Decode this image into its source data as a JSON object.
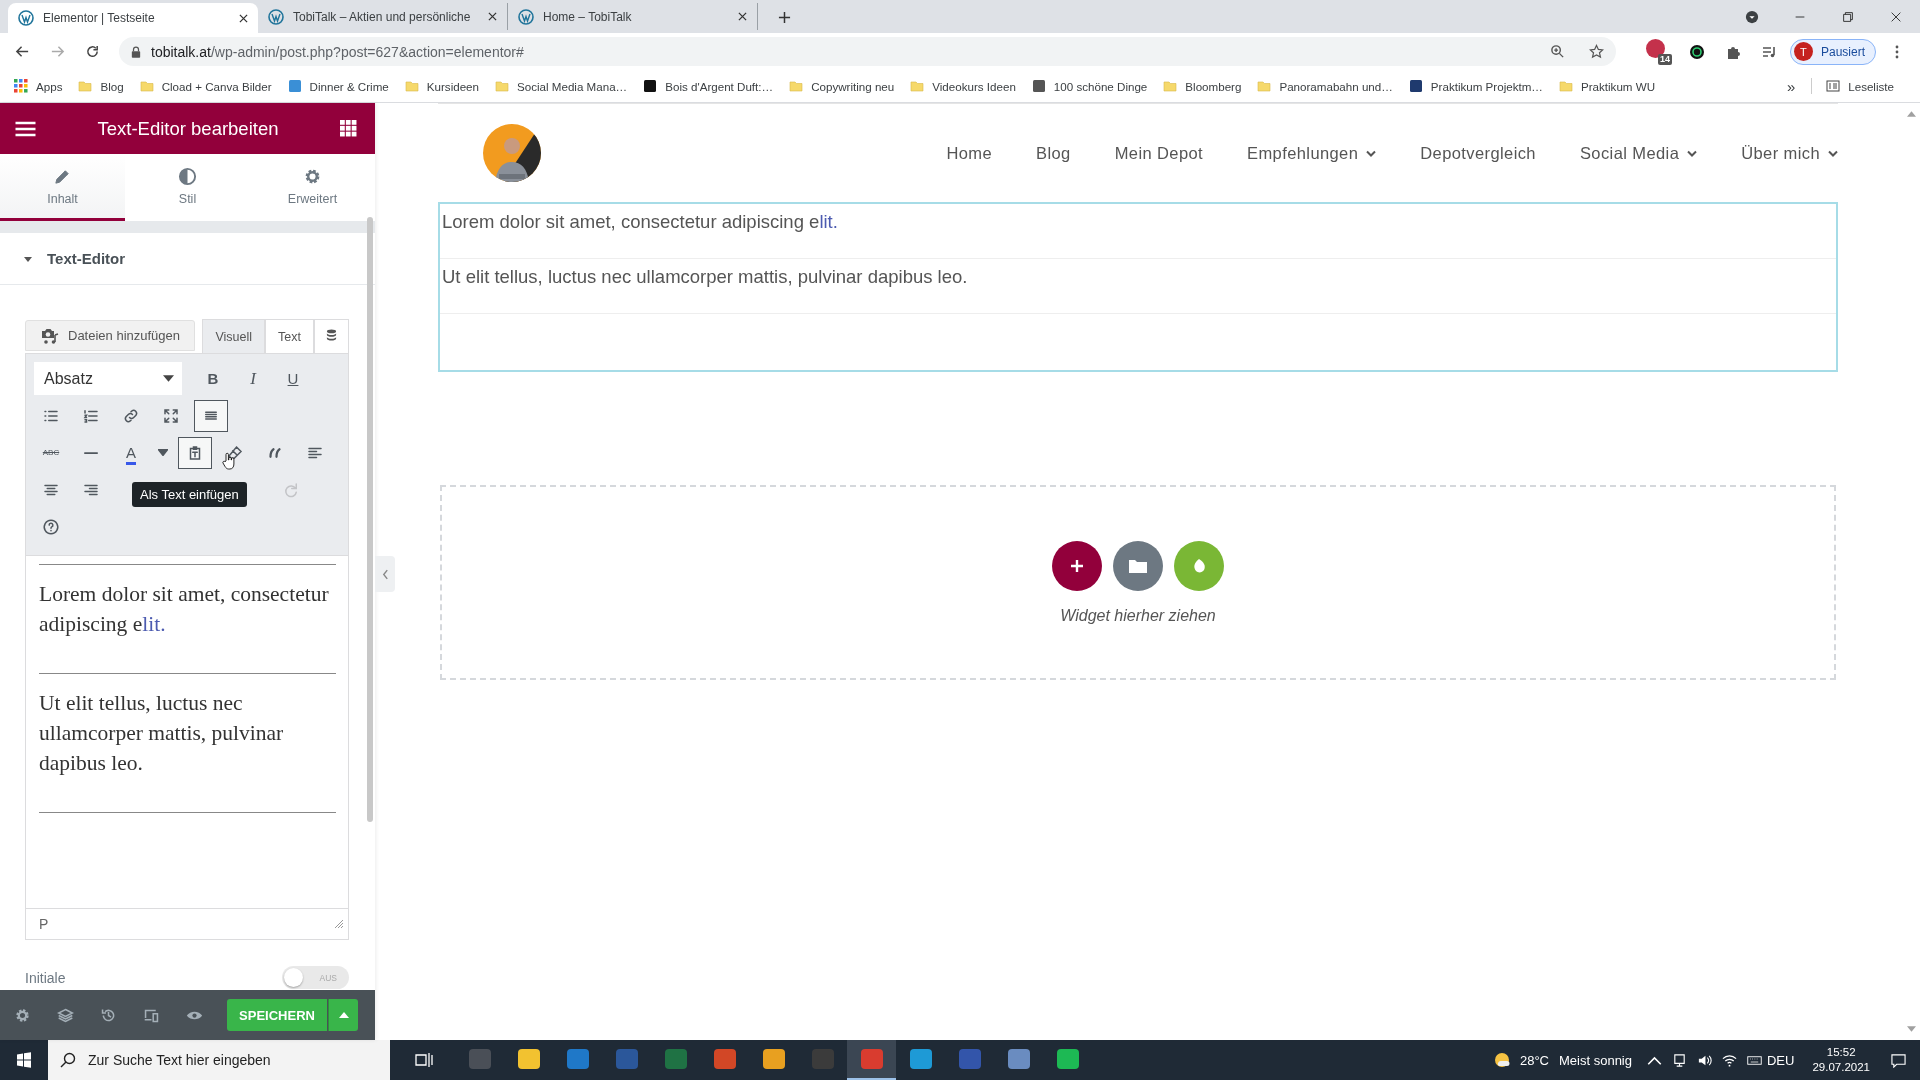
{
  "browser": {
    "tabs": [
      {
        "title": "Elementor | Testseite",
        "selected": true
      },
      {
        "title": "TobiTalk – Aktien und persönliche",
        "selected": false
      },
      {
        "title": "Home – TobiTalk",
        "selected": false
      }
    ],
    "url_host": "tobitalk.at",
    "url_path": "/wp-admin/post.php?post=627&action=elementor#",
    "extension_badge": "14",
    "profile_initial": "T",
    "profile_status": "Pausiert",
    "bookmarks": [
      {
        "kind": "apps",
        "label": "Apps"
      },
      {
        "kind": "folder",
        "label": "Blog"
      },
      {
        "kind": "folder",
        "label": "Cload + Canva Bilder"
      },
      {
        "kind": "favicon",
        "label": "Dinner & Crime",
        "color": "#3a8fd6"
      },
      {
        "kind": "folder",
        "label": "Kursideen"
      },
      {
        "kind": "folder",
        "label": "Social Media Mana…"
      },
      {
        "kind": "favicon",
        "label": "Bois d'Argent Duft:…",
        "color": "#111111"
      },
      {
        "kind": "folder",
        "label": "Copywriting neu"
      },
      {
        "kind": "folder",
        "label": "Videokurs Ideen"
      },
      {
        "kind": "favicon",
        "label": "100 schöne Dinge",
        "color": "#555555"
      },
      {
        "kind": "folder",
        "label": "Bloomberg"
      },
      {
        "kind": "folder",
        "label": "Panoramabahn und…"
      },
      {
        "kind": "favicon",
        "label": "Praktikum Projektm…",
        "color": "#1f3a6e"
      },
      {
        "kind": "folder",
        "label": "Praktikum WU"
      }
    ],
    "more": "»",
    "reading_list": "Leseliste"
  },
  "panel": {
    "title": "Text-Editor bearbeiten",
    "tabs": [
      {
        "label": "Inhalt",
        "kind": "pencil",
        "selected": true
      },
      {
        "label": "Stil",
        "kind": "contrast",
        "selected": false
      },
      {
        "label": "Erweitert",
        "kind": "gear",
        "selected": false
      }
    ],
    "section": {
      "title": "Text-Editor",
      "expanded": true
    },
    "editor": {
      "add_media": "Dateien hinzufügen",
      "modes": [
        {
          "label": "Visuell",
          "selected": true
        },
        {
          "label": "Text",
          "selected": false
        }
      ],
      "format": "Absatz",
      "toolbar": [
        [
          {
            "kind": "bold",
            "glyph": "B",
            "pressed": false,
            "disabled": false
          },
          {
            "kind": "italic",
            "glyph": "I",
            "pressed": false,
            "disabled": false
          },
          {
            "kind": "underline",
            "glyph": "U",
            "pressed": false,
            "disabled": false
          }
        ],
        [
          {
            "kind": "bullist",
            "pressed": false,
            "disabled": false
          },
          {
            "kind": "numlist",
            "pressed": false,
            "disabled": false
          },
          {
            "kind": "link",
            "pressed": false,
            "disabled": false
          },
          {
            "kind": "fullscreen",
            "pressed": false,
            "disabled": false
          },
          {
            "kind": "toolbar",
            "pressed": true,
            "disabled": false
          }
        ],
        [
          {
            "kind": "strike",
            "glyph": "ABC",
            "pressed": false,
            "disabled": false
          },
          {
            "kind": "hr",
            "pressed": false,
            "disabled": false
          },
          {
            "kind": "color",
            "glyph": "A",
            "pressed": false,
            "disabled": false
          },
          {
            "kind": "caret",
            "pressed": false,
            "disabled": false
          },
          {
            "kind": "paste",
            "pressed": true,
            "disabled": false
          },
          {
            "kind": "eraser",
            "pressed": false,
            "disabled": false
          },
          {
            "kind": "quote",
            "pressed": false,
            "disabled": false
          },
          {
            "kind": "alignleft",
            "pressed": false,
            "disabled": false
          }
        ],
        [
          {
            "kind": "aligncenter",
            "pressed": false,
            "disabled": false
          },
          {
            "kind": "alignright",
            "pressed": false,
            "disabled": false
          },
          {
            "kind": "gap"
          },
          {
            "kind": "gap"
          },
          {
            "kind": "gap"
          },
          {
            "kind": "gap"
          },
          {
            "kind": "redo",
            "pressed": false,
            "disabled": true
          }
        ],
        [
          {
            "kind": "help",
            "pressed": false,
            "disabled": false
          }
        ]
      ],
      "tooltip": "Als Text einfügen",
      "paragraphs": [
        [
          {
            "text": "Lorem dolor sit amet, consectetur adipiscing e",
            "highlighted": false
          },
          {
            "text": "lit.",
            "highlighted": true
          }
        ],
        [
          {
            "text": "Ut elit tellus, luctus nec ullamcorper mattis, pulvinar dapibus leo.",
            "highlighted": false
          }
        ]
      ],
      "path": "P"
    },
    "toggle": {
      "label": "Initiale",
      "on": false,
      "state_text": "AUS"
    },
    "save": "SPEICHERN"
  },
  "canvas": {
    "nav": [
      {
        "label": "Home",
        "dropdown": false
      },
      {
        "label": "Blog",
        "dropdown": false
      },
      {
        "label": "Mein Depot",
        "dropdown": false
      },
      {
        "label": "Empfehlungen",
        "dropdown": true
      },
      {
        "label": "Depotvergleich",
        "dropdown": false
      },
      {
        "label": "Social Media",
        "dropdown": true
      },
      {
        "label": "Über mich",
        "dropdown": true
      }
    ],
    "paragraphs": [
      [
        {
          "text": "Lorem dolor sit amet, consectetur adipiscing e",
          "highlighted": false
        },
        {
          "text": "lit.",
          "highlighted": true
        }
      ],
      [
        {
          "text": "Ut elit tellus, luctus nec ullamcorper mattis, pulvinar dapibus leo.",
          "highlighted": false
        }
      ]
    ],
    "dropzone": "Widget hierher ziehen"
  },
  "taskbar": {
    "search_placeholder": "Zur Suche Text hier eingeben",
    "apps": [
      {
        "color": "#4a4f57",
        "active": false
      },
      {
        "color": "#f2c230",
        "active": false
      },
      {
        "color": "#1f78c8",
        "active": false
      },
      {
        "color": "#2b579a",
        "active": false
      },
      {
        "color": "#1f7244",
        "active": false
      },
      {
        "color": "#d24726",
        "active": false
      },
      {
        "color": "#e8a020",
        "active": false
      },
      {
        "color": "#3b3b3b",
        "active": false
      },
      {
        "color": "#d93c2f",
        "active": true
      },
      {
        "color": "#1e9ad6",
        "active": false
      },
      {
        "color": "#3355aa",
        "active": false
      },
      {
        "color": "#6a8cc0",
        "active": false
      },
      {
        "color": "#1db954",
        "active": false
      }
    ],
    "temperature": "28°C",
    "weather": "Meist sonnig",
    "language": "DEU",
    "time": "15:52",
    "date": "29.07.2021"
  }
}
